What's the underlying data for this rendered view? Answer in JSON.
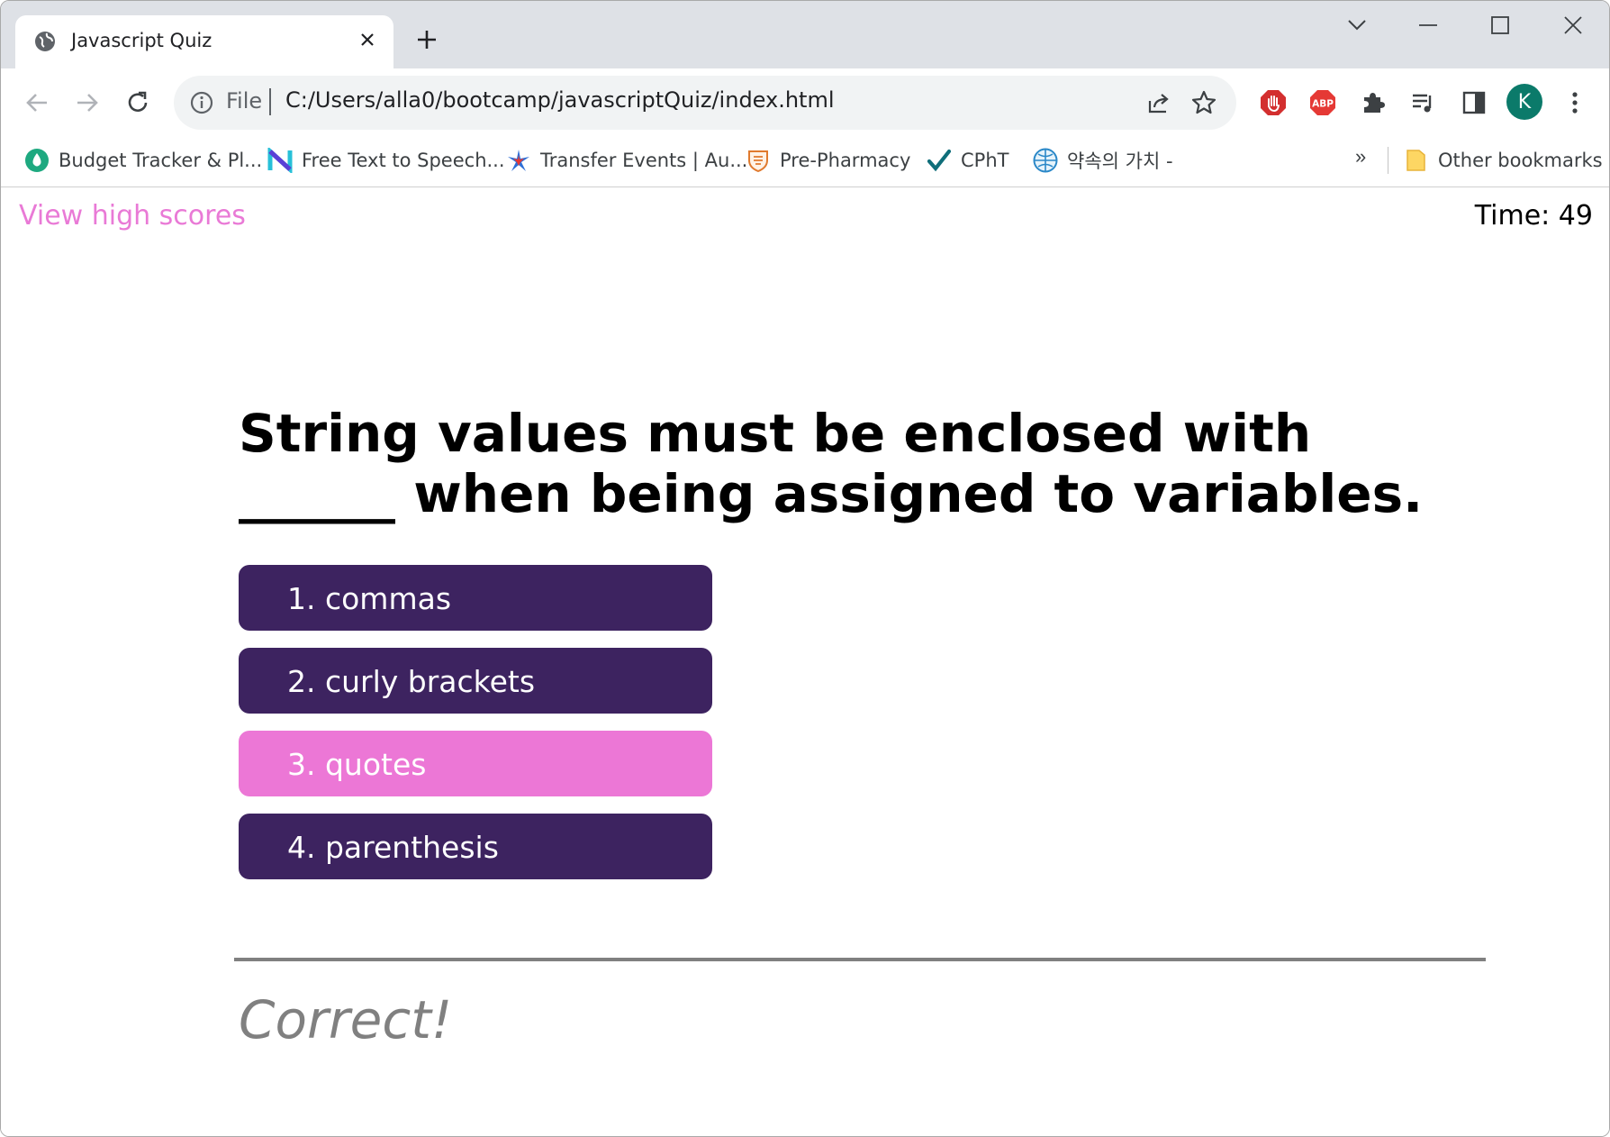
{
  "browser": {
    "tab_title": "Javascript Quiz",
    "address_scheme": "File",
    "address_url": "C:/Users/alla0/bootcamp/javascriptQuiz/index.html",
    "profile_initial": "K",
    "bookmarks": [
      {
        "label": "Budget Tracker & Pl...",
        "icon": "drop-icon"
      },
      {
        "label": "Free Text to Speech...",
        "icon": "n-logo-icon"
      },
      {
        "label": "Transfer Events | Au...",
        "icon": "star-burst-icon"
      },
      {
        "label": "Pre-Pharmacy",
        "icon": "shield-crest-icon"
      },
      {
        "label": "CPhT",
        "icon": "checkmark-icon"
      },
      {
        "label": "약속의 가치 -",
        "icon": "globe-emblem-icon"
      }
    ],
    "more_bookmarks": "»",
    "other_bookmarks": "Other bookmarks"
  },
  "quiz": {
    "high_scores_link": "View high scores",
    "timer": "Time: 49",
    "question": "String values must be enclosed with ______ when being assigned to variables.",
    "choices": [
      {
        "label": "1. commas",
        "selected": false
      },
      {
        "label": "2. curly brackets",
        "selected": false
      },
      {
        "label": "3. quotes",
        "selected": true
      },
      {
        "label": "4. parenthesis",
        "selected": false
      }
    ],
    "result": "Correct!"
  },
  "colors": {
    "choice_bg": "#3d2360",
    "choice_selected_bg": "#ec77d6",
    "link": "#e97ad6",
    "result": "#808080"
  }
}
